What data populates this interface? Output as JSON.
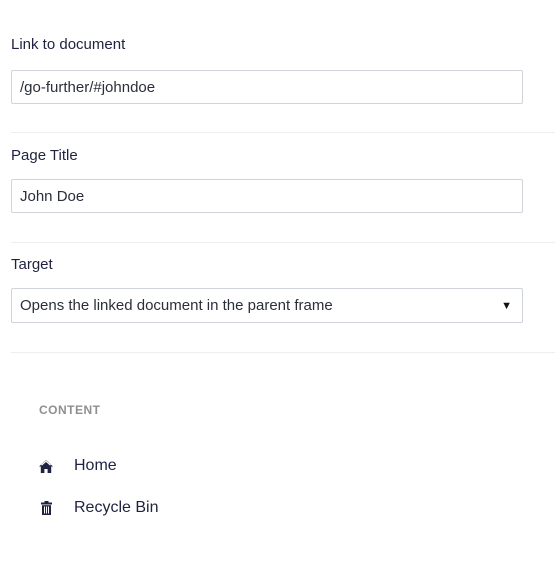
{
  "link_field": {
    "label": "Link to document",
    "value": "/go-further/#johndoe"
  },
  "title_field": {
    "label": "Page Title",
    "value": "John Doe"
  },
  "target_field": {
    "label": "Target",
    "selected": "Opens the linked document in the parent frame"
  },
  "content_section": {
    "title": "CONTENT",
    "items": [
      {
        "label": "Home",
        "icon": "home-icon"
      },
      {
        "label": "Recycle Bin",
        "icon": "trash-icon"
      }
    ]
  }
}
